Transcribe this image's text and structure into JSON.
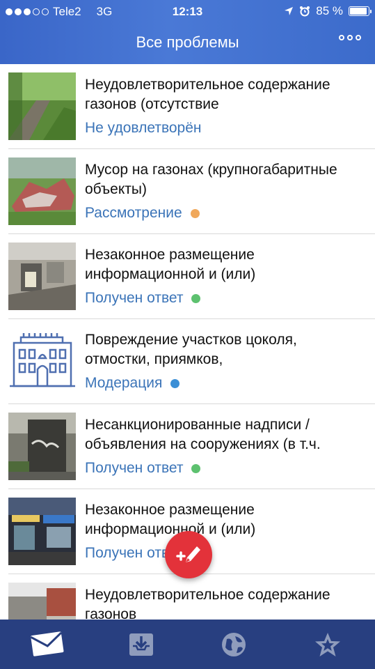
{
  "status_bar": {
    "carrier": "Tele2",
    "network": "3G",
    "time": "12:13",
    "battery": "85 %",
    "battery_level": 0.85
  },
  "nav": {
    "title": "Все проблемы",
    "more_icon": "ellipsis-icon"
  },
  "colors": {
    "accent": "#3b74b8",
    "header": "#4a79d6",
    "tabbar": "#283f80",
    "fab": "#e3323a",
    "status_orange": "#f0a85b",
    "status_green": "#5dc16f",
    "status_blue": "#3b8fd6"
  },
  "problems": [
    {
      "title": "Неудовлетворительное содержание газонов (отсутствие",
      "status": "Не удовлетворён",
      "status_color": ""
    },
    {
      "title": "Мусор на газонах (крупногабаритные объекты)",
      "status": "Рассмотрение",
      "status_color": "#f0a85b"
    },
    {
      "title": "Незаконное размещение информационной и (или)",
      "status": "Получен ответ",
      "status_color": "#5dc16f"
    },
    {
      "title": "Повреждение участков цоколя, отмостки, приямков,",
      "status": "Модерация",
      "status_color": "#3b8fd6"
    },
    {
      "title": "Несанкционированные надписи / объявления на сооружениях (в т.ч.",
      "status": "Получен ответ",
      "status_color": "#5dc16f"
    },
    {
      "title": "Незаконное размещение информационной и (или)",
      "status": "Получен ответ",
      "status_color": "#5dc16f"
    },
    {
      "title": "Неудовлетворительное содержание газонов",
      "status": "",
      "status_color": ""
    }
  ],
  "fab": {
    "icon": "add-problem-pencil-icon"
  },
  "tabs": [
    {
      "icon": "mail-icon"
    },
    {
      "icon": "inbox-download-icon"
    },
    {
      "icon": "globe-icon"
    },
    {
      "icon": "star-icon"
    }
  ]
}
